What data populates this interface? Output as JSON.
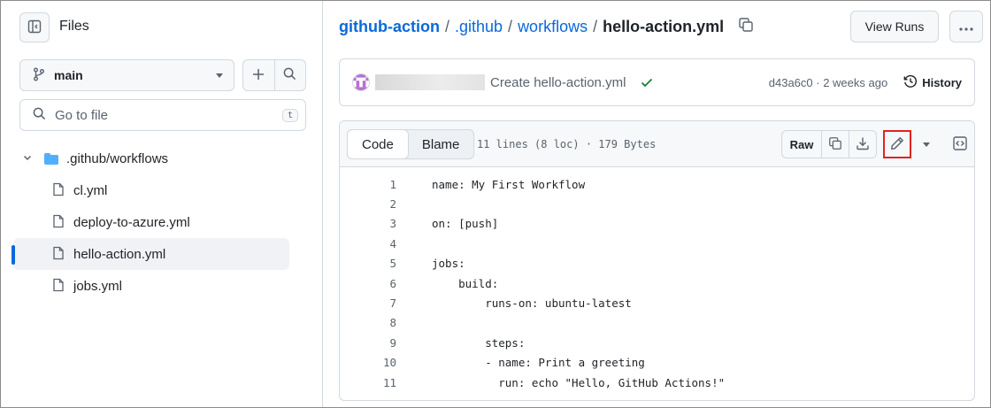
{
  "sidebar": {
    "title": "Files",
    "branch": "main",
    "goto_placeholder": "Go to file",
    "goto_shortcut": "t",
    "tree": [
      {
        "type": "folder",
        "name": ".github/workflows"
      },
      {
        "type": "file",
        "name": "cl.yml"
      },
      {
        "type": "file",
        "name": "deploy-to-azure.yml"
      },
      {
        "type": "file",
        "name": "hello-action.yml",
        "active": true
      },
      {
        "type": "file",
        "name": "jobs.yml"
      }
    ]
  },
  "breadcrumb": {
    "repo": "github-action",
    "sep": "/",
    "dir1": ".github",
    "dir2": "workflows",
    "file": "hello-action.yml"
  },
  "header": {
    "view_runs": "View Runs"
  },
  "commit": {
    "message": "Create hello-action.yml",
    "sha_time": "d43a6c0 · 2 weeks ago",
    "history_label": "History"
  },
  "file": {
    "tabs": [
      "Code",
      "Blame"
    ],
    "info": "11 lines (8 loc) · 179 Bytes",
    "raw_label": "Raw",
    "lines": [
      {
        "n": "1",
        "text": "name: My First Workflow"
      },
      {
        "n": "2",
        "text": ""
      },
      {
        "n": "3",
        "text": "on: [push]"
      },
      {
        "n": "4",
        "text": ""
      },
      {
        "n": "5",
        "text": "jobs:"
      },
      {
        "n": "6",
        "text": "    build:"
      },
      {
        "n": "7",
        "text": "        runs-on: ubuntu-latest"
      },
      {
        "n": "8",
        "text": ""
      },
      {
        "n": "9",
        "text": "        steps:"
      },
      {
        "n": "10",
        "text": "        - name: Print a greeting"
      },
      {
        "n": "11",
        "text": "          run: echo \"Hello, GitHub Actions!\""
      }
    ]
  },
  "colors": {
    "link": "#0969da",
    "highlight_box": "#e02424",
    "success": "#1a7f37"
  }
}
